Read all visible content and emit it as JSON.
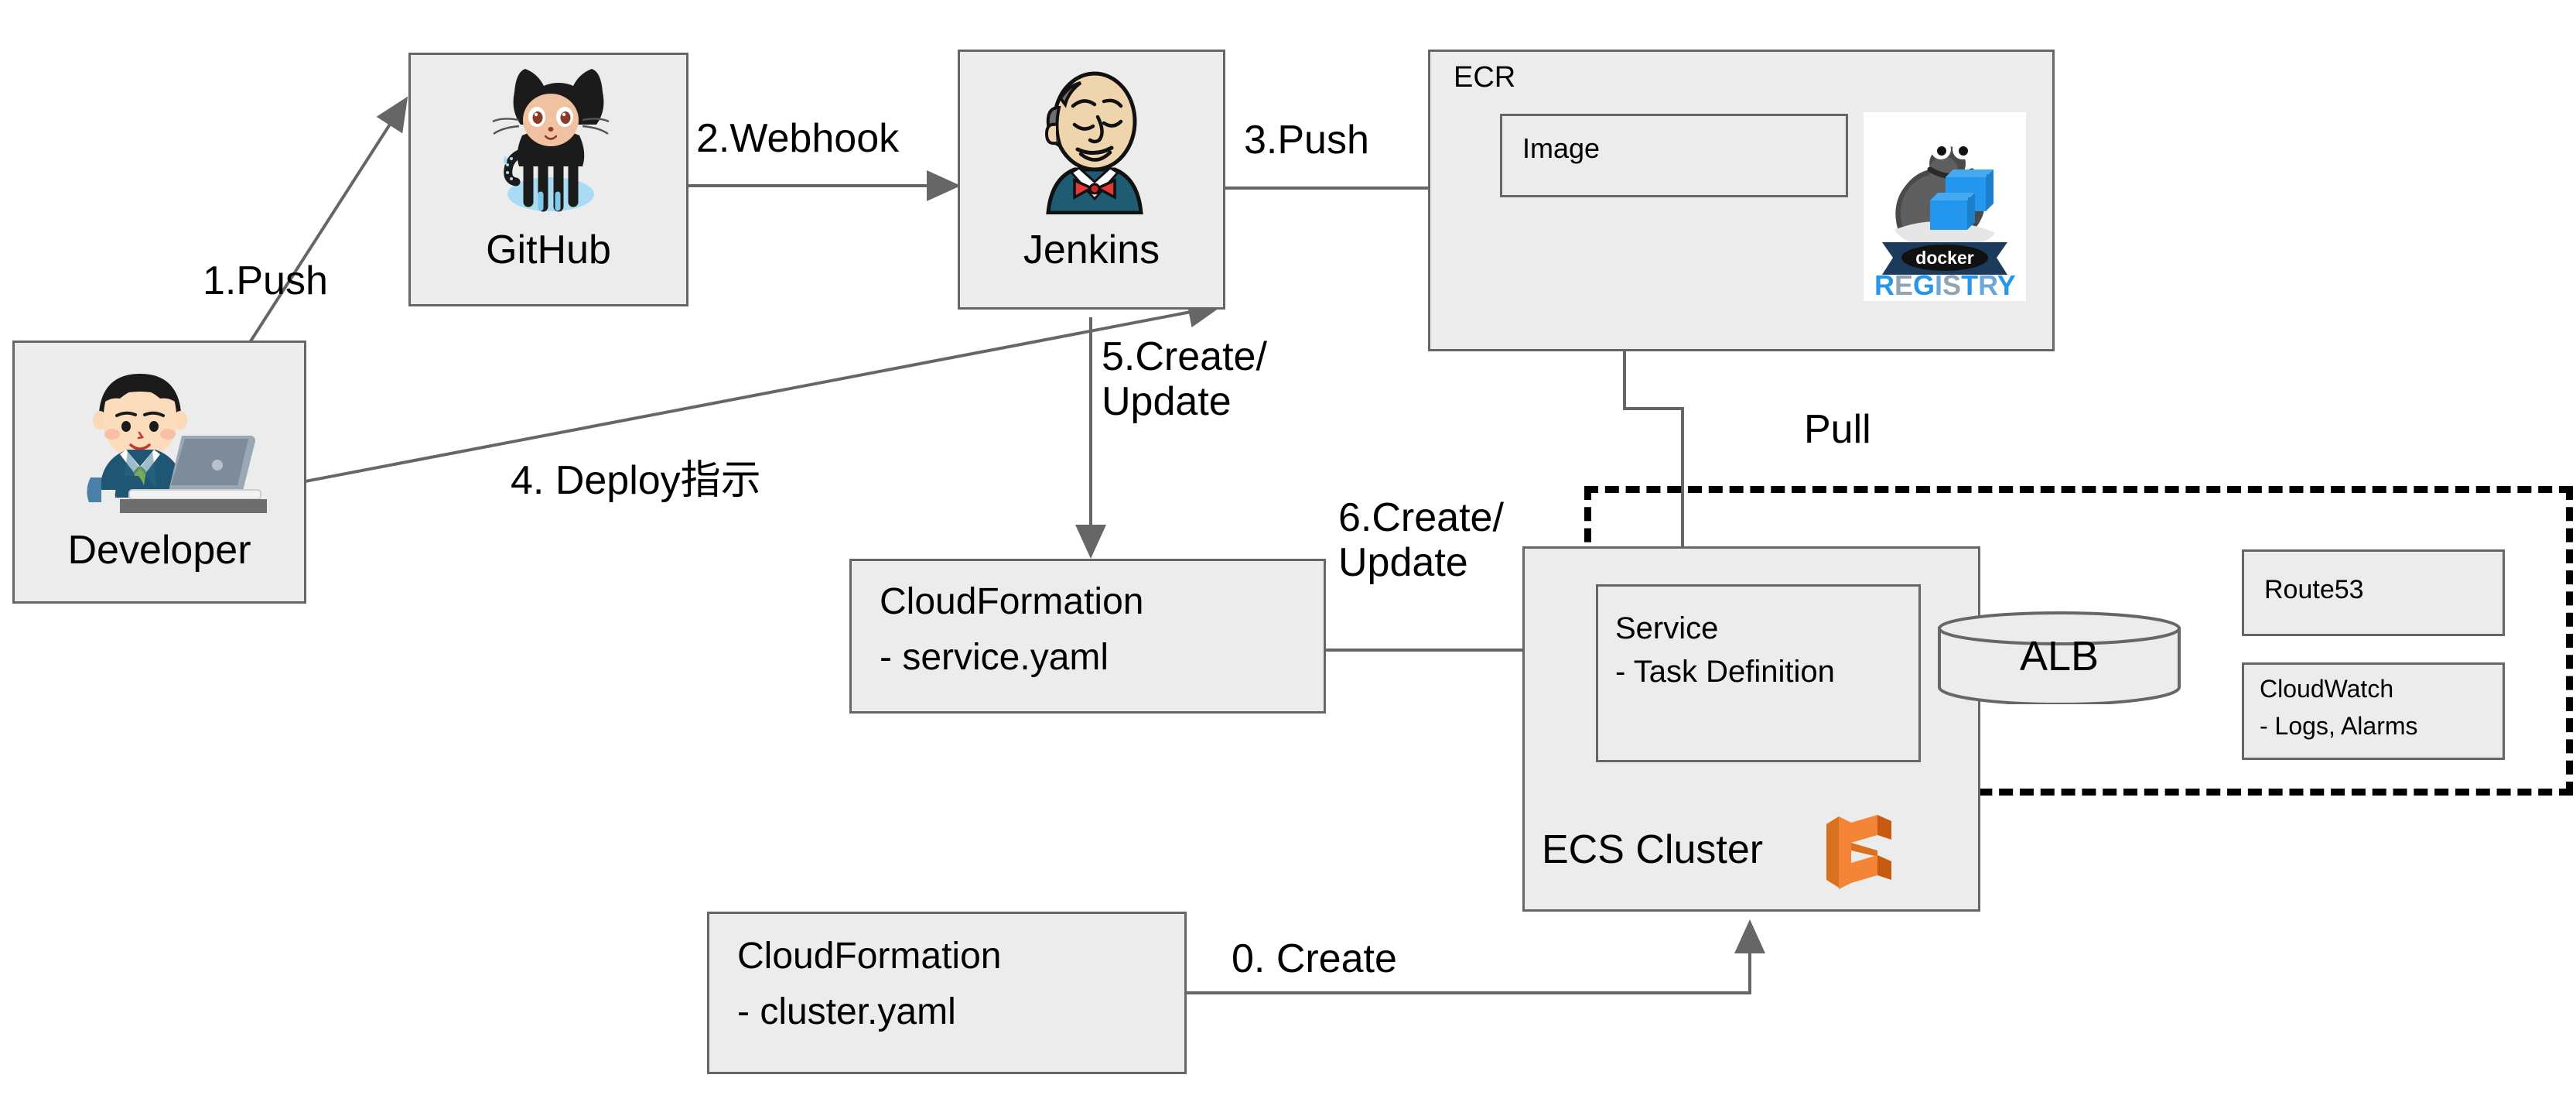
{
  "diagram": {
    "title": "AWS ECS CI/CD deployment flow",
    "colors": {
      "box_fill": "#ECECEC",
      "box_border": "#666666",
      "edge": "#666666",
      "dashed_border": "#000000",
      "ecs_orange": "#F58536",
      "text": "#000000"
    }
  },
  "nodes": {
    "developer": {
      "label": "Developer",
      "icon": "developer-at-laptop-icon"
    },
    "github": {
      "label": "GitHub",
      "icon": "github-octocat-icon"
    },
    "jenkins": {
      "label": "Jenkins",
      "icon": "jenkins-butler-icon"
    },
    "ecr": {
      "label": "ECR",
      "icon": "docker-registry-whale-icon"
    },
    "ecr_image": {
      "label": "Image"
    },
    "docker_registry": {
      "word_top": "docker",
      "word_bottom": "REGISTRY"
    },
    "cfn_service": {
      "line1": "CloudFormation",
      "line2": "- service.yaml"
    },
    "cfn_cluster": {
      "line1": "CloudFormation",
      "line2": "- cluster.yaml"
    },
    "ecs_cluster": {
      "label": "ECS Cluster",
      "icon": "ecs-cluster-icon"
    },
    "service": {
      "line1": "Service",
      "line2": "- Task Definition"
    },
    "alb": {
      "label": "ALB"
    },
    "route53": {
      "label": "Route53"
    },
    "cloudwatch": {
      "line1": "CloudWatch",
      "line2": "- Logs, Alarms"
    }
  },
  "edges": {
    "push": "1.Push",
    "webhook": "2.Webhook",
    "image_push": "3.Push",
    "deploy_instruction": "4. Deploy指示",
    "create_update_cfn": "5.Create/\nUpdate",
    "create_update_service": "6.Create/\nUpdate",
    "pull": "Pull",
    "create_cluster": "0. Create"
  }
}
